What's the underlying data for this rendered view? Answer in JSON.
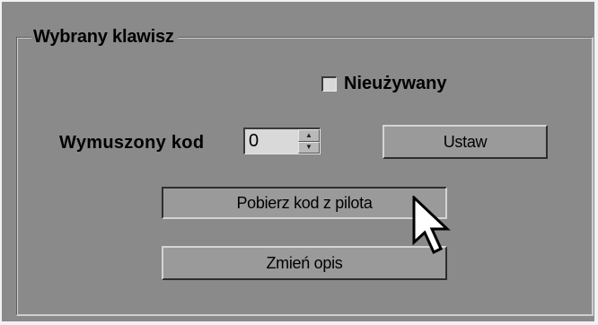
{
  "group": {
    "title": "Wybrany klawisz"
  },
  "unused_checkbox": {
    "label": "Nieużywany",
    "checked": false
  },
  "forced_code": {
    "label": "Wymuszony kod",
    "value": "0"
  },
  "buttons": {
    "set_label": "Ustaw",
    "fetch_label": "Pobierz kod z pilota",
    "edit_label": "Zmień opis"
  },
  "icons": {
    "spin_up": "spin-up-icon",
    "spin_down": "spin-down-icon",
    "cursor": "mouse-pointer-icon"
  },
  "colors": {
    "panel": "#8a8a8a",
    "button": "#9a9a9a"
  }
}
